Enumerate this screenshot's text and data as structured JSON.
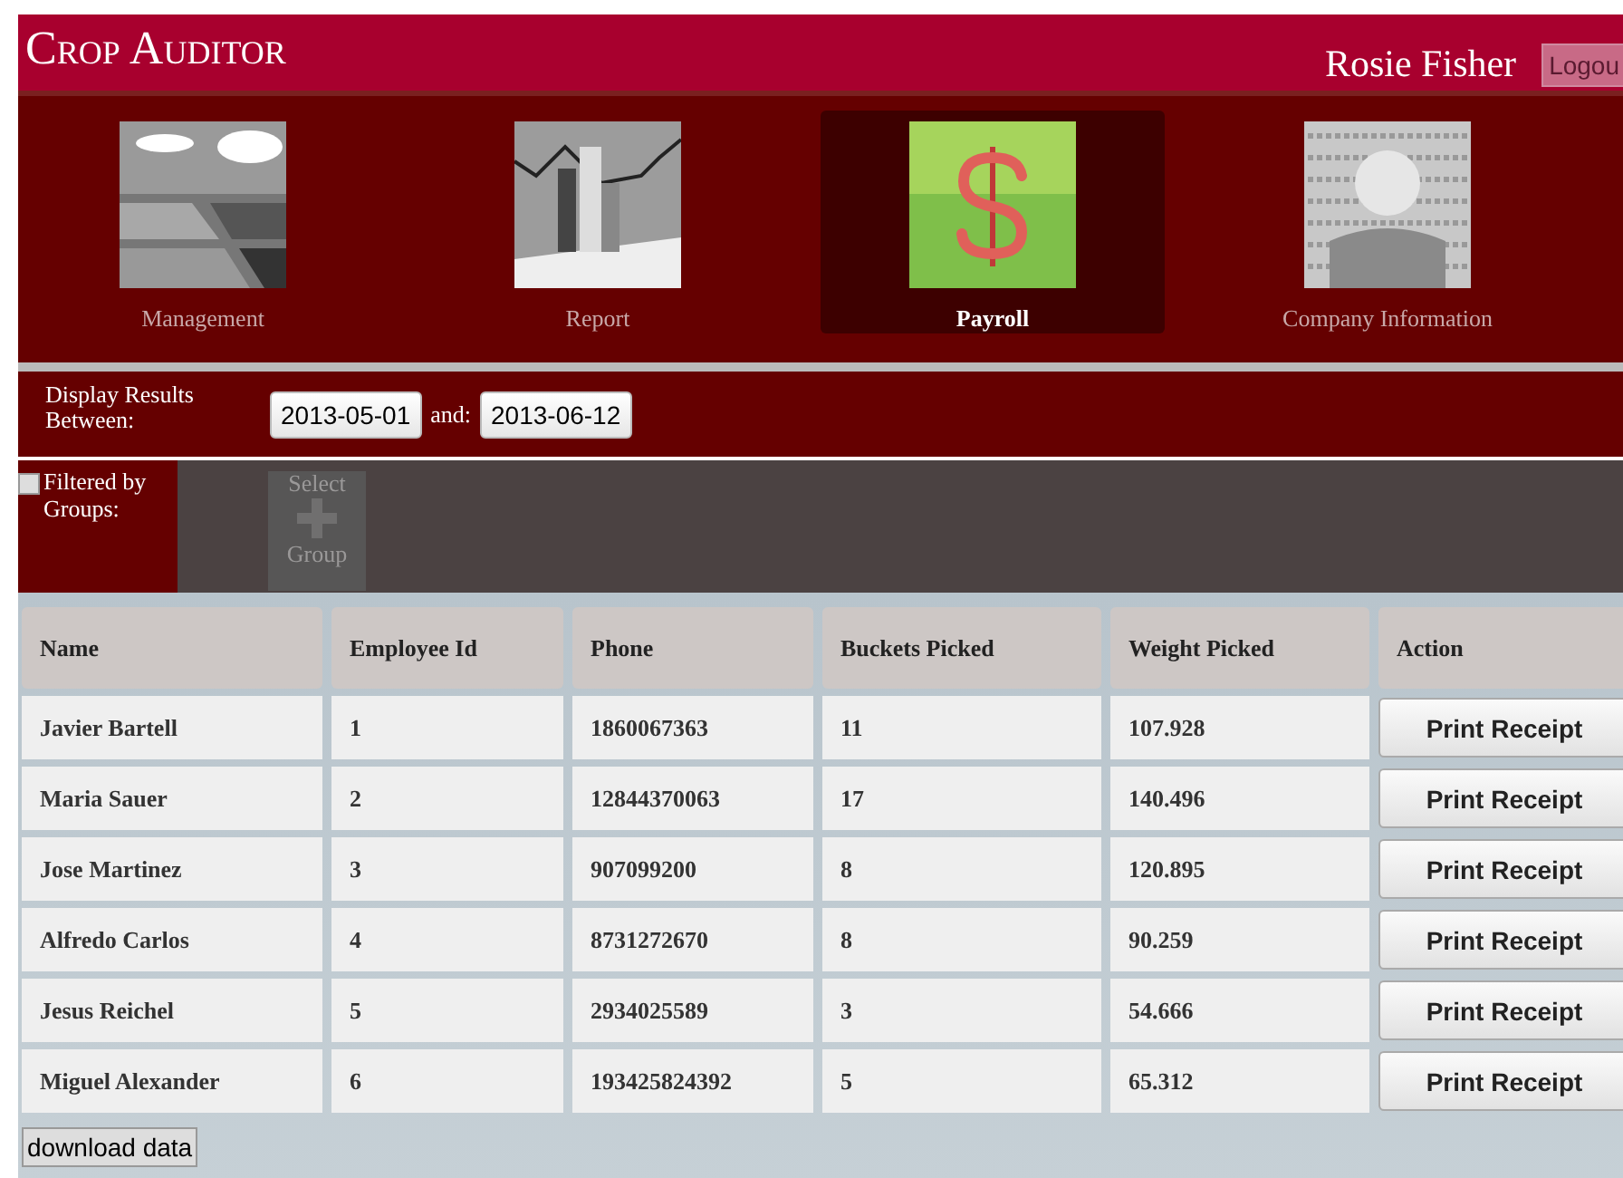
{
  "header": {
    "title": "Crop Auditor",
    "user": "Rosie Fisher",
    "logout": "Logou"
  },
  "nav": [
    {
      "label": "Management",
      "kind": "fields",
      "selected": false
    },
    {
      "label": "Report",
      "kind": "chart",
      "selected": false
    },
    {
      "label": "Payroll",
      "kind": "dollar",
      "selected": true
    },
    {
      "label": "Company Information",
      "kind": "person",
      "selected": false
    }
  ],
  "date_filter": {
    "label": "Display Results Between:",
    "from": "2013-05-01",
    "joiner": "and:",
    "to": "2013-06-12"
  },
  "group_filter": {
    "label": "Filtered by Groups:",
    "checked": false,
    "select_button": {
      "top": "Select",
      "bottom": "Group",
      "disabled": true
    }
  },
  "table": {
    "columns": [
      "Name",
      "Employee Id",
      "Phone",
      "Buckets Picked",
      "Weight Picked",
      "Action"
    ],
    "rows": [
      {
        "cells": [
          "Javier Bartell",
          "1",
          "1860067363",
          "11",
          "107.928"
        ],
        "action": "Print Receipt"
      },
      {
        "cells": [
          "Maria Sauer",
          "2",
          "12844370063",
          "17",
          "140.496"
        ],
        "action": "Print Receipt"
      },
      {
        "cells": [
          "Jose Martinez",
          "3",
          "907099200",
          "8",
          "120.895"
        ],
        "action": "Print Receipt"
      },
      {
        "cells": [
          "Alfredo Carlos",
          "4",
          "8731272670",
          "8",
          "90.259"
        ],
        "action": "Print Receipt"
      },
      {
        "cells": [
          "Jesus Reichel",
          "5",
          "2934025589",
          "3",
          "54.666"
        ],
        "action": "Print Receipt"
      },
      {
        "cells": [
          "Miguel Alexander",
          "6",
          "193425824392",
          "5",
          "65.312"
        ],
        "action": "Print Receipt"
      }
    ]
  },
  "download": "download data"
}
